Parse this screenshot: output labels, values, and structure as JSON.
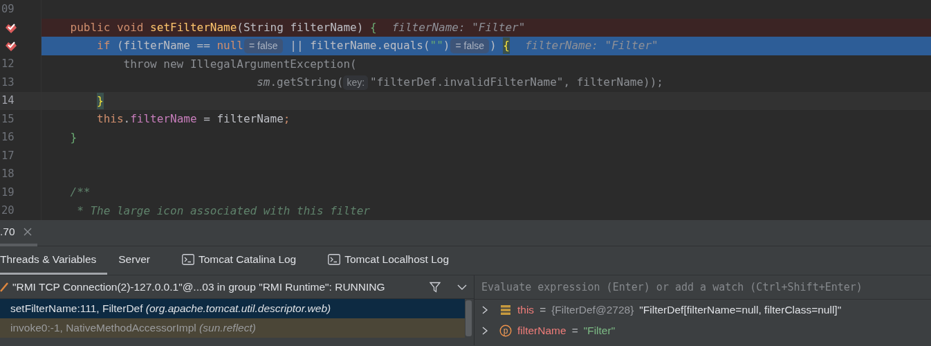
{
  "editor": {
    "lines": [
      {
        "number": "09",
        "breakpoint": false,
        "current": false,
        "caret": false
      },
      {
        "breakpoint": true,
        "current": false,
        "caret": false,
        "tokens": [
          {
            "kind": "keyword",
            "text": "public void "
          },
          {
            "kind": "declaration",
            "text": "setFilterName"
          },
          {
            "kind": "plain",
            "text": "(String filterName) "
          },
          {
            "kind": "brace",
            "text": "{"
          },
          {
            "kind": "hint",
            "text": "filterName: \"Filter\""
          }
        ],
        "children": [
          {
            "breakpoint": true,
            "current": true,
            "caret": false,
            "tokens": [
              {
                "kind": "keyword",
                "text": "if "
              },
              {
                "kind": "plain",
                "text": "(filterName == "
              },
              {
                "kind": "keyword",
                "text": "null"
              },
              {
                "kind": "value-pill",
                "text": "= false"
              },
              {
                "kind": "plain",
                "text": " || filterName.equals("
              },
              {
                "kind": "string",
                "text": "\"\""
              },
              {
                "kind": "plain",
                "text": ")"
              },
              {
                "kind": "value-pill",
                "text": "= false"
              },
              {
                "kind": "plain",
                "text": ") "
              },
              {
                "kind": "matched-brace",
                "text": "{"
              },
              {
                "kind": "hint",
                "text": "filterName: \"Filter\""
              }
            ],
            "children": [
              {
                "number": "12",
                "breakpoint": false,
                "current": false,
                "caret": false,
                "tokens": [
                  {
                    "kind": "dim",
                    "text": "throw new IllegalArgumentException("
                  }
                ],
                "children": [
                  {
                    "number": "13",
                    "kind": "continuation",
                    "breakpoint": false,
                    "current": false,
                    "caret": false,
                    "tokens": [
                      {
                        "kind": "dim-italic",
                        "text": "sm"
                      },
                      {
                        "kind": "dim",
                        "text": ".getString("
                      },
                      {
                        "kind": "param-pill",
                        "text": "key:"
                      },
                      {
                        "kind": "dim",
                        "text": "\"filterDef.invalidFilterName\", filterName));"
                      }
                    ]
                  }
                ]
              }
            ]
          },
          {
            "number": "14",
            "breakpoint": false,
            "current": false,
            "caret": true,
            "tokens": [
              {
                "kind": "matched-brace",
                "text": "}"
              }
            ]
          },
          {
            "number": "15",
            "breakpoint": false,
            "current": false,
            "caret": false,
            "tokens": [
              {
                "kind": "keyword",
                "text": "this"
              },
              {
                "kind": "plain",
                "text": "."
              },
              {
                "kind": "field",
                "text": "filterName"
              },
              {
                "kind": "plain",
                "text": " = filterName"
              },
              {
                "kind": "keyword",
                "text": ";"
              }
            ]
          }
        ]
      },
      {
        "number": "16",
        "breakpoint": false,
        "current": false,
        "caret": false,
        "tokens": [
          {
            "kind": "brace",
            "text": "}"
          }
        ]
      },
      {
        "number": "17",
        "breakpoint": false,
        "current": false,
        "caret": false
      },
      {
        "number": "18",
        "breakpoint": false,
        "current": false,
        "caret": false
      },
      {
        "number": "19",
        "breakpoint": false,
        "current": false,
        "caret": false,
        "tokens": [
          {
            "kind": "comment",
            "text": "/**"
          }
        ]
      },
      {
        "number": "20",
        "breakpoint": false,
        "current": false,
        "caret": false,
        "tokens": [
          {
            "kind": "doc-comment",
            "text": "* The large icon associated with this filter"
          }
        ]
      }
    ]
  },
  "debug_panel": {
    "session_tab": {
      "label": ".70",
      "selected": true
    },
    "tabs": [
      {
        "label": "Threads & Variables",
        "selected": true,
        "kind": "view"
      },
      {
        "label": "Server",
        "selected": false,
        "kind": "view"
      },
      {
        "label": "Tomcat Catalina Log",
        "selected": false,
        "kind": "console"
      },
      {
        "label": "Tomcat Localhost Log",
        "selected": false,
        "kind": "console"
      }
    ],
    "thread": "\"RMI TCP Connection(2)-127.0.0.1\"@...03 in group \"RMI Runtime\": RUNNING",
    "frames": [
      {
        "method": "setFilterName:111, FilterDef",
        "package": "(org.apache.tomcat.util.descriptor.web)",
        "selected": true,
        "library": false
      },
      {
        "method": "invoke0:-1, NativeMethodAccessorImpl",
        "package": "(sun.reflect)",
        "selected": false,
        "library": true
      }
    ],
    "evaluate": {
      "placeholder": "Evaluate expression (Enter) or add a watch (Ctrl+Shift+Enter)"
    },
    "variables": [
      {
        "kind": "object",
        "name": "this",
        "operator": "=",
        "type": "{FilterDef@2728}",
        "value": {
          "kind": "text",
          "text": "\"FilterDef[filterName=null, filterClass=null]\""
        }
      },
      {
        "kind": "parameter",
        "badge": "p",
        "name": "filterName",
        "operator": "=",
        "value": {
          "kind": "string",
          "text": "\"Filter\""
        }
      }
    ]
  }
}
